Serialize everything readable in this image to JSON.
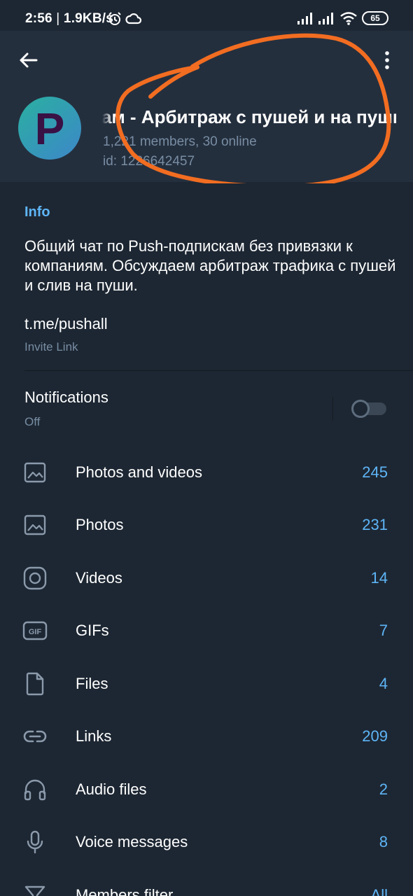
{
  "status_bar": {
    "time": "2:56",
    "net_speed": "1.9KB/s",
    "battery": "65"
  },
  "header": {
    "title": "кам - Арбитраж с пушей и на пуши",
    "members": "1,221 members, 30 online",
    "chat_id": "id: 1226642457",
    "avatar_letter": "P"
  },
  "info": {
    "heading": "Info",
    "description": "Общий чат по Push-подпискам без привязки к компаниям. Обсуждаем арбитраж трафика с пушей и слив на пуши.",
    "link": "t.me/pushall",
    "link_caption": "Invite Link"
  },
  "notifications": {
    "label": "Notifications",
    "status": "Off",
    "enabled": false
  },
  "media": [
    {
      "icon": "photo-icon",
      "label": "Photos and videos",
      "count": "245"
    },
    {
      "icon": "photo-icon",
      "label": "Photos",
      "count": "231"
    },
    {
      "icon": "video-icon",
      "label": "Videos",
      "count": "14"
    },
    {
      "icon": "gif-icon",
      "label": "GIFs",
      "count": "7"
    },
    {
      "icon": "file-icon",
      "label": "Files",
      "count": "4"
    },
    {
      "icon": "link-icon",
      "label": "Links",
      "count": "209"
    },
    {
      "icon": "headphones-icon",
      "label": "Audio files",
      "count": "2"
    },
    {
      "icon": "microphone-icon",
      "label": "Voice messages",
      "count": "8"
    },
    {
      "icon": "filter-icon",
      "label": "Members filter",
      "count": "All"
    }
  ],
  "colors": {
    "background": "#1d2733",
    "header": "#242f3e",
    "accent": "#5eb5f7",
    "secondary_text": "#788da3",
    "annotation": "#f26d21"
  }
}
